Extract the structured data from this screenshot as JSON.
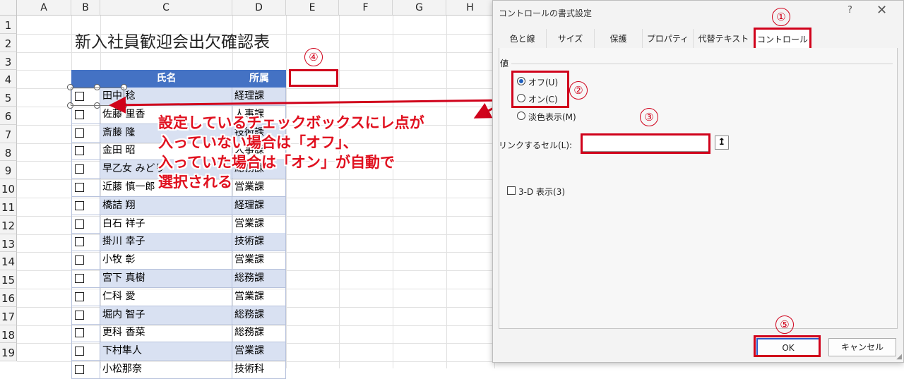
{
  "sheet": {
    "columns": [
      "A",
      "B",
      "C",
      "D",
      "E",
      "F",
      "G",
      "H"
    ],
    "rows": [
      "1",
      "2",
      "3",
      "4",
      "5",
      "6",
      "7",
      "8",
      "9",
      "10",
      "11",
      "12",
      "13",
      "14",
      "15",
      "16",
      "17",
      "18",
      "19"
    ],
    "title": "新入社員歓迎会出欠確認表",
    "headers": {
      "name": "氏名",
      "dept": "所属"
    },
    "records": [
      {
        "name": "田中 稔",
        "dept": "経理課"
      },
      {
        "name": "佐藤 里香",
        "dept": "人事課"
      },
      {
        "name": "斎藤 隆",
        "dept": "技術課"
      },
      {
        "name": "金田 昭",
        "dept": "人事課"
      },
      {
        "name": "早乙女 みどり",
        "dept": "総務課"
      },
      {
        "name": "近藤 慎一郎",
        "dept": "営業課"
      },
      {
        "name": "橋詰 翔",
        "dept": "経理課"
      },
      {
        "name": "白石 祥子",
        "dept": "営業課"
      },
      {
        "name": "掛川 幸子",
        "dept": "技術課"
      },
      {
        "name": "小牧 彰",
        "dept": "営業課"
      },
      {
        "name": "宮下 真樹",
        "dept": "総務課"
      },
      {
        "name": "仁科 愛",
        "dept": "営業課"
      },
      {
        "name": "堀内 智子",
        "dept": "総務課"
      },
      {
        "name": "更科 香菜",
        "dept": "総務課"
      },
      {
        "name": "下村隼人",
        "dept": "営業課"
      },
      {
        "name": "小松那奈",
        "dept": "技術科"
      }
    ]
  },
  "annotation": {
    "lines": [
      "設定しているチェックボックスにレ点が",
      "入っていない場合は「オフ」、",
      "入っていた場合は「オン」が自動で",
      "選択される"
    ],
    "color": "#e0101f"
  },
  "markers": {
    "m1": "①",
    "m2": "②",
    "m3": "③",
    "m4": "④",
    "m5": "⑤"
  },
  "dialog": {
    "title": "コントロールの書式設定",
    "help": "?",
    "close": "✕",
    "tabs": [
      "色と線",
      "サイズ",
      "保護",
      "プロパティ",
      "代替テキスト",
      "コントロール"
    ],
    "active_tab": "コントロール",
    "value_group": "値",
    "radio_off": "オフ(U)",
    "radio_on": "オン(C)",
    "radio_mixed": "淡色表示(M)",
    "selected_value": "オフ(U)",
    "link_cell_label": "リンクするセル(L):",
    "link_cell_value": "",
    "collapse_icon": "↥",
    "shading_3d": "3-D 表示(3)",
    "shading_3d_checked": false,
    "ok": "OK",
    "cancel": "キャンセル"
  },
  "colors": {
    "header_blue": "#4472c4",
    "band": "#d9e1f2",
    "accent_red": "#d0021b",
    "ok_border": "#2b5ac8"
  }
}
